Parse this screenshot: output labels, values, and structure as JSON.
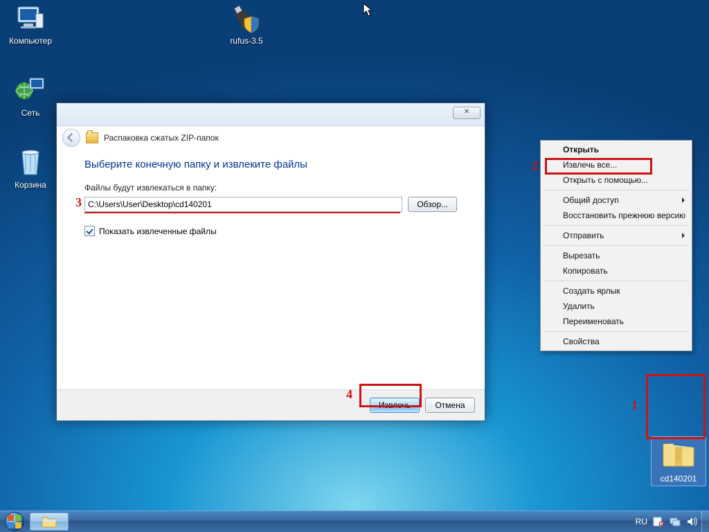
{
  "desktop_icons": {
    "computer": "Компьютер",
    "network": "Сеть",
    "recycle": "Корзина",
    "rufus": "rufus-3.5"
  },
  "zip_icon_label": "cd140201",
  "dialog": {
    "title": "Распаковка сжатых ZIP-папок",
    "close_glyph": "✕",
    "heading": "Выберите конечную папку и извлеките файлы",
    "path_label": "Файлы будут извлекаться в папку:",
    "path_value": "C:\\Users\\User\\Desktop\\cd140201",
    "browse": "Обзор...",
    "show_extracted": "Показать извлеченные файлы",
    "extract": "Извлечь",
    "cancel": "Отмена"
  },
  "context_menu": {
    "open": "Открыть",
    "extract_all": "Извлечь все...",
    "open_with": "Открыть с помощью...",
    "share": "Общий доступ",
    "restore_prev": "Восстановить прежнюю версию",
    "send_to": "Отправить",
    "cut": "Вырезать",
    "copy": "Копировать",
    "shortcut": "Создать ярлык",
    "delete": "Удалить",
    "rename": "Переименовать",
    "properties": "Свойства"
  },
  "annotations": {
    "n1": "1",
    "n2": "2",
    "n3": "3",
    "n4": "4"
  },
  "taskbar": {
    "lang": "RU"
  }
}
